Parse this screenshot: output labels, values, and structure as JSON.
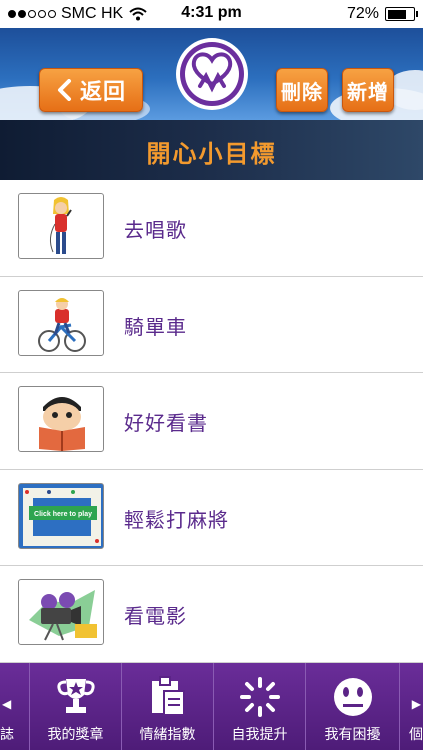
{
  "status_bar": {
    "carrier": "SMC HK",
    "time": "4:31 pm",
    "battery_percent": "72%",
    "battery_level": 0.72,
    "signal_dots_filled": 2,
    "signal_dots_total": 5
  },
  "header": {
    "back_label": "返回",
    "delete_label": "刪除",
    "add_label": "新增",
    "logo_icon": "heart-people-logo"
  },
  "title": "開心小目標",
  "goals": [
    {
      "label": "去唱歌",
      "icon": "singing-girl-icon"
    },
    {
      "label": "騎單車",
      "icon": "cycling-boy-icon"
    },
    {
      "label": "好好看書",
      "icon": "reading-boy-icon"
    },
    {
      "label": "輕鬆打麻將",
      "icon": "mahjong-game-icon",
      "overlay_text": "Click here to play"
    },
    {
      "label": "看電影",
      "icon": "movie-camera-icon"
    }
  ],
  "bottom_nav": {
    "partial_left_label": "誌",
    "items": [
      {
        "label": "我的獎章",
        "icon": "trophy-icon"
      },
      {
        "label": "情緒指數",
        "icon": "clipboard-icon"
      },
      {
        "label": "自我提升",
        "icon": "loading-spinner-icon"
      },
      {
        "label": "我有困擾",
        "icon": "neutral-face-icon"
      }
    ],
    "partial_right_label": "個"
  },
  "colors": {
    "accent_orange": "#f39a2e",
    "purple": "#5a2a8c",
    "nav_purple": "#5b2387"
  }
}
